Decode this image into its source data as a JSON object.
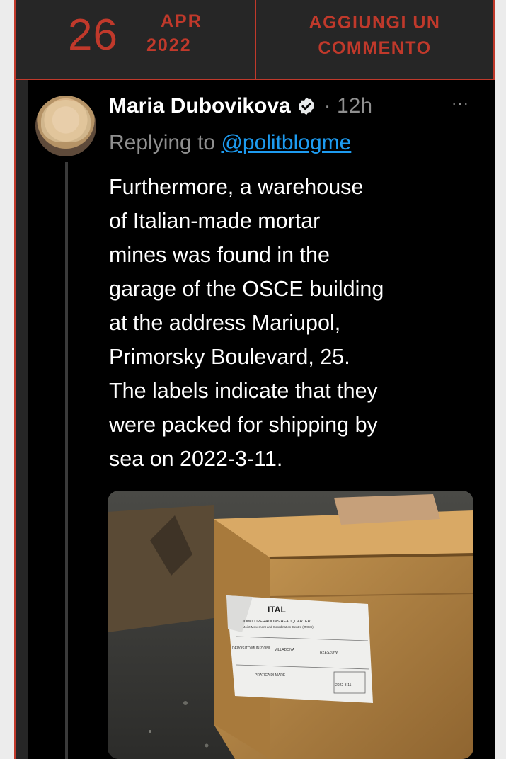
{
  "date": {
    "day": "26",
    "month": "APR",
    "year": "2022"
  },
  "comment_link": {
    "line1": "AGGIUNGI UN",
    "line2": "COMMENTO"
  },
  "tweet": {
    "author": "Maria Dubovikova",
    "verified_icon": "verified-badge-icon",
    "time": "· 12h",
    "more_icon": "···",
    "replying_prefix": "Replying to",
    "replying_handle": "@politblogme",
    "body_lines": [
      "Furthermore, a warehouse",
      "of Italian-made mortar",
      "mines was found in the",
      "garage of the OSCE building",
      "at the address Mariupol,",
      "Primorsky Boulevard, 25.",
      "The labels indicate that they",
      "were packed for shipping by",
      "sea on 2022-3-11."
    ],
    "photo": {
      "label_heading": "ITAL",
      "label_line1": "JOINT OPERATIONS HEADQUARTER",
      "label_line2": "Joint Movement and Coordination Centre (JMCC)",
      "label_dep1": "DEPOSITO MUNIZIONI",
      "label_dep2": "VILLADONA",
      "label_dest": "RZESZOW",
      "label_pratica": "PRATICA DI MARE",
      "label_date": "2022-3-11"
    }
  },
  "colors": {
    "accent": "#c0392b",
    "bar_bg": "#262626",
    "tweet_bg": "#000000",
    "link": "#1d9bf0",
    "muted": "#8f8f8f"
  }
}
